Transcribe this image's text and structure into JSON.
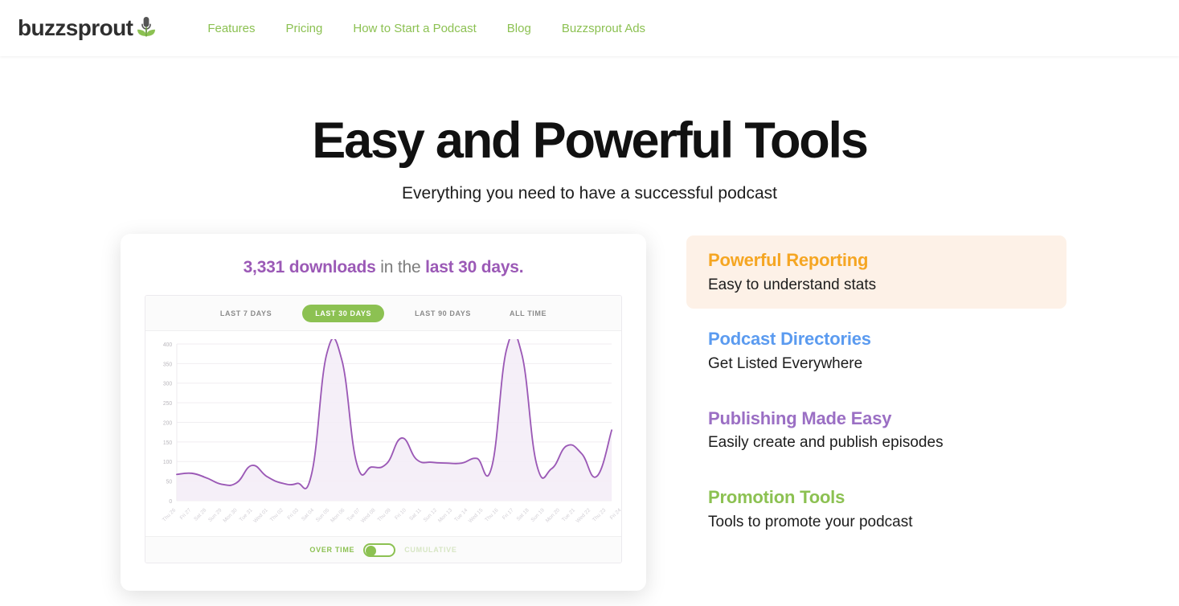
{
  "header": {
    "brand": "buzzsprout",
    "brand_icon": "sprout-microphone-icon",
    "nav": [
      {
        "label": "Features"
      },
      {
        "label": "Pricing"
      },
      {
        "label": "How to Start a Podcast"
      },
      {
        "label": "Blog"
      },
      {
        "label": "Buzzsprout Ads"
      }
    ]
  },
  "hero": {
    "title": "Easy and Powerful Tools",
    "subtitle": "Everything you need to have a successful podcast"
  },
  "card": {
    "headline": {
      "count": "3,331 downloads",
      "middle": " in the ",
      "range": "last 30 days."
    },
    "tabs": [
      {
        "label": "LAST 7 DAYS",
        "active": false
      },
      {
        "label": "LAST 30 DAYS",
        "active": true
      },
      {
        "label": "LAST 90 DAYS",
        "active": false
      },
      {
        "label": "ALL TIME",
        "active": false
      }
    ],
    "footer": {
      "left_label": "OVER TIME",
      "right_label": "CUMULATIVE",
      "toggle_state": "over-time"
    }
  },
  "features": [
    {
      "title": "Powerful Reporting",
      "desc": "Easy to understand stats",
      "color": "#f5a623",
      "active": true
    },
    {
      "title": "Podcast Directories",
      "desc": "Get Listed Everywhere",
      "color": "#5b9bf0",
      "active": false
    },
    {
      "title": "Publishing Made Easy",
      "desc": "Easily create and publish episodes",
      "color": "#9b6fc4",
      "active": false
    },
    {
      "title": "Promotion Tools",
      "desc": "Tools to promote your podcast",
      "color": "#8cc152",
      "active": false
    }
  ],
  "chart_data": {
    "type": "area",
    "title": "3,331 downloads in the last 30 days.",
    "xlabel": "",
    "ylabel": "",
    "ylim": [
      0,
      400
    ],
    "yticks": [
      0,
      50,
      100,
      150,
      200,
      250,
      300,
      350,
      400
    ],
    "grid": true,
    "line_color": "#9b59b6",
    "fill_color": "#f3ecf7",
    "legend": "none",
    "x": [
      "Thu 26",
      "Fri 27",
      "Sat 28",
      "Sun 29",
      "Mon 30",
      "Tue 31",
      "Wed 01",
      "Thu 02",
      "Fri 03",
      "Sat 04",
      "Sun 05",
      "Mon 06",
      "Tue 07",
      "Wed 08",
      "Thu 09",
      "Fri 10",
      "Sat 11",
      "Sun 12",
      "Mon 13",
      "Tue 14",
      "Wed 15",
      "Thu 16",
      "Fri 17",
      "Sat 18",
      "Sun 19",
      "Mon 20",
      "Tue 21",
      "Wed 22",
      "Thu 23",
      "Fri 24"
    ],
    "series": [
      {
        "name": "Downloads",
        "values": [
          67,
          70,
          58,
          42,
          46,
          90,
          62,
          45,
          44,
          70,
          375,
          360,
          95,
          86,
          95,
          160,
          105,
          98,
          96,
          96,
          108,
          86,
          388,
          375,
          92,
          82,
          140,
          120,
          62,
          180
        ]
      }
    ]
  }
}
